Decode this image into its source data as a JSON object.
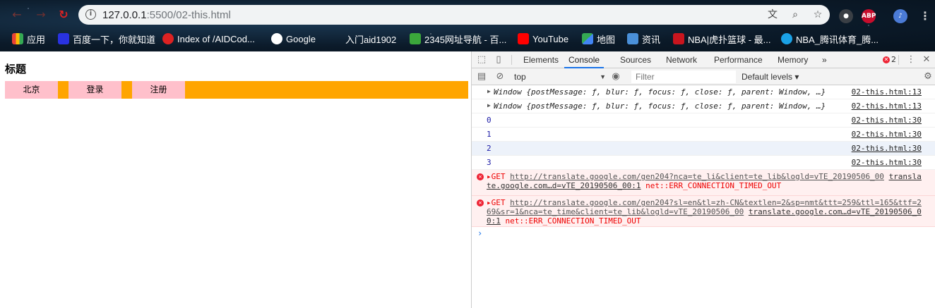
{
  "browser": {
    "url_host": "127.0.0.1",
    "url_rest": ":5500/02-this.html",
    "icons": [
      "back-icon",
      "forward-icon",
      "reload-icon",
      "info-icon",
      "translate-icon",
      "zoom-icon",
      "star-icon"
    ],
    "extensions": {
      "abp": "ABP"
    }
  },
  "bookmarks": [
    {
      "label": "应用",
      "color": "#e94235"
    },
    {
      "label": "百度一下，你就知道",
      "color": "#2932e1"
    },
    {
      "label": "Index of /AIDCod...",
      "color": "#d22"
    },
    {
      "label": "Google",
      "color": "#ffffff"
    },
    {
      "label": "入门aid1902",
      "color": "#f4b400"
    },
    {
      "label": "2345网址导航 - 百...",
      "color": "#3ba73b"
    },
    {
      "label": "YouTube",
      "color": "#ff0000"
    },
    {
      "label": "地图",
      "color": "#34a853"
    },
    {
      "label": "资讯",
      "color": "#4a90d9"
    },
    {
      "label": "NBA|虎扑篮球 - 最...",
      "color": "#c9151e"
    },
    {
      "label": "NBA_腾讯体育_腾...",
      "color": "#1aa1e6"
    }
  ],
  "page": {
    "title": "标题",
    "nav": [
      "北京",
      "登录",
      "注册"
    ]
  },
  "devtools": {
    "tabs": [
      "Elements",
      "Console",
      "Sources",
      "Network",
      "Performance",
      "Memory"
    ],
    "more": "»",
    "active_tab": "Console",
    "error_count": "2",
    "context": "top",
    "filter_placeholder": "Filter",
    "levels": "Default levels ▾",
    "logs": [
      {
        "text": "Window {postMessage: ƒ, blur: ƒ, focus: ƒ, close: ƒ, parent: Window, …}",
        "source": "02-this.html:13"
      },
      {
        "text": "Window {postMessage: ƒ, blur: ƒ, focus: ƒ, close: ƒ, parent: Window, …}",
        "source": "02-this.html:13"
      },
      {
        "text": "0",
        "source": "02-this.html:30"
      },
      {
        "text": "1",
        "source": "02-this.html:30"
      },
      {
        "text": "2",
        "source": "02-this.html:30"
      },
      {
        "text": "3",
        "source": "02-this.html:30"
      }
    ],
    "errors": [
      {
        "method": "GET",
        "url": "http://translate.google.com/gen204?nca=te_li&client=te_lib&logld=vTE_20190506_00",
        "source": "translate.google.com…d=vTE_20190506_00:1",
        "message": "net::ERR_CONNECTION_TIMED_OUT"
      },
      {
        "method": "GET",
        "url": "http://translate.google.com/gen204?sl=en&tl=zh-CN&textlen=2&sp=nmt&ttt=259&ttl=165&ttf=269&sr=1&nca=te_time&client=te_lib&logld=vTE_20190506_00",
        "source": "translate.google.com…d=vTE_20190506_00:1",
        "message": "net::ERR_CONNECTION_TIMED_OUT"
      }
    ],
    "prompt": "›"
  }
}
